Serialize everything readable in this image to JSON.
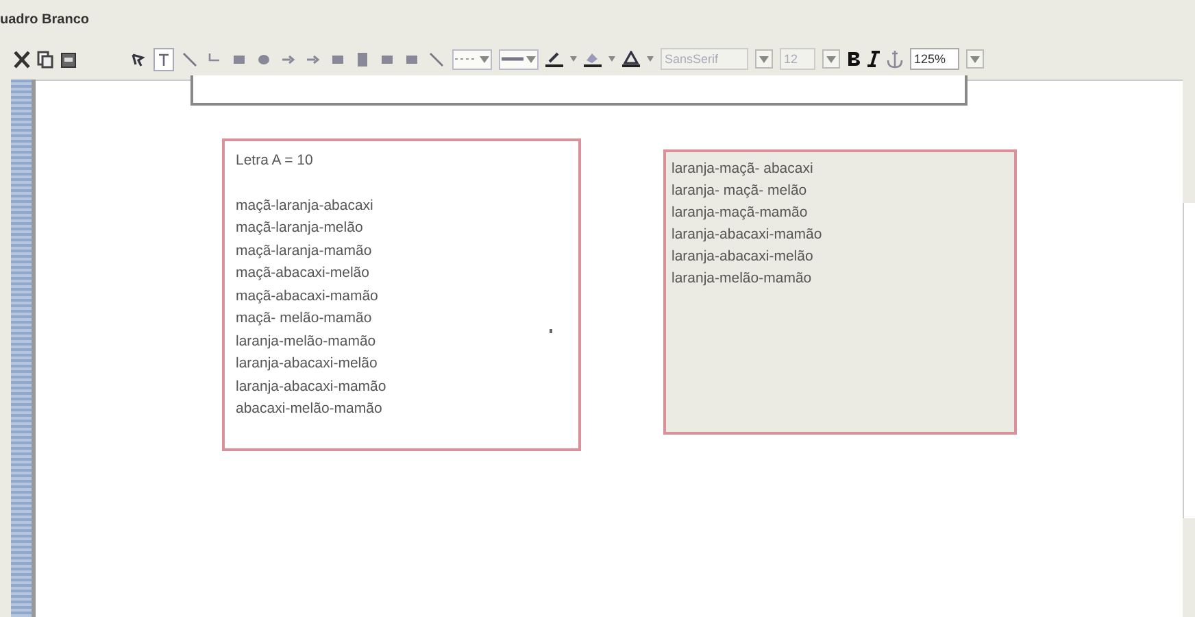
{
  "window": {
    "title": "uadro Branco"
  },
  "toolbar": {
    "tools": [
      {
        "kind": "select",
        "selected": false
      },
      {
        "kind": "text",
        "selected": true
      },
      {
        "kind": "line",
        "selected": false
      },
      {
        "kind": "connector",
        "selected": false
      },
      {
        "kind": "rect",
        "selected": false
      },
      {
        "kind": "ellipse",
        "selected": false
      },
      {
        "kind": "arrow",
        "selected": false
      },
      {
        "kind": "arrow",
        "selected": false
      },
      {
        "kind": "rect",
        "selected": false
      },
      {
        "kind": "tall",
        "selected": false
      },
      {
        "kind": "rect",
        "selected": false
      },
      {
        "kind": "rect",
        "selected": false
      },
      {
        "kind": "line",
        "selected": false
      }
    ],
    "font": {
      "value": "SansSerif",
      "disabled": true
    },
    "size": {
      "value": "12",
      "disabled": true
    },
    "zoom": "125%"
  },
  "canvas": {
    "boxes": [
      {
        "kind": "empty",
        "filled": false
      },
      {
        "kind": "text",
        "filled": false,
        "heading": "Letra A = 10",
        "lines": [
          "maçã-laranja-abacaxi",
          "maçã-laranja-melão",
          "maçã-laranja-mamão",
          "maçã-abacaxi-melão",
          "maçã-abacaxi-mamão",
          "maçã- melão-mamão",
          "laranja-melão-mamão",
          "laranja-abacaxi-melão",
          "laranja-abacaxi-mamão",
          "abacaxi-melão-mamão"
        ]
      },
      {
        "kind": "text",
        "filled": true,
        "lines": [
          "laranja-maçã- abacaxi",
          "laranja- maçã- melão",
          "laranja-maçã-mamão",
          "laranja-abacaxi-mamão",
          "laranja-abacaxi-melão",
          "laranja-melão-mamão"
        ]
      }
    ]
  }
}
